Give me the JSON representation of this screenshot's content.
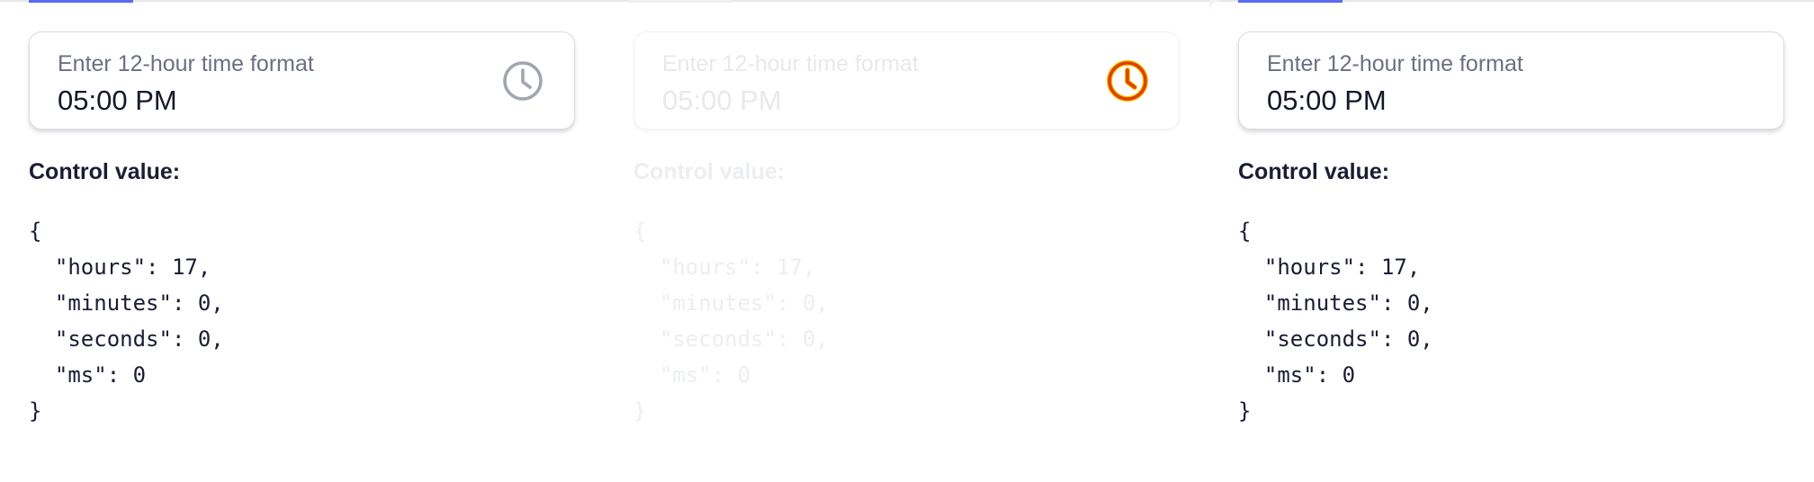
{
  "panels": [
    {
      "state": "default",
      "field": {
        "label": "Enter 12-hour time format",
        "value": "05:00 PM",
        "clock_icon_color": "#a1a5b0"
      },
      "control_value_label": "Control value:",
      "json_lines": [
        "{",
        "  \"hours\": 17,",
        "  \"minutes\": 0,",
        "  \"seconds\": 0,",
        "  \"ms\": 0",
        "}"
      ]
    },
    {
      "state": "disabled",
      "field": {
        "label": "Enter 12-hour time format",
        "value": "05:00 PM",
        "clock_icon_color": "#e13f00"
      },
      "control_value_label": "Control value:",
      "json_lines": [
        "{",
        "  \"hours\": 17,",
        "  \"minutes\": 0,",
        "  \"seconds\": 0,",
        "  \"ms\": 0",
        "}"
      ]
    },
    {
      "state": "no-icon",
      "field": {
        "label": "Enter 12-hour time format",
        "value": "05:00 PM"
      },
      "control_value_label": "Control value:",
      "json_lines": [
        "{",
        "  \"hours\": 17,",
        "  \"minutes\": 0,",
        "  \"seconds\": 0,",
        "  \"ms\": 0",
        "}"
      ]
    }
  ],
  "colors": {
    "accent": "#5b6cf0",
    "text_primary": "#1a1d33",
    "text_muted": "#6b7080",
    "disabled_text": "#e8e9ec",
    "clock_default": "#a1a5b0",
    "clock_highlight": "#e13f00"
  }
}
